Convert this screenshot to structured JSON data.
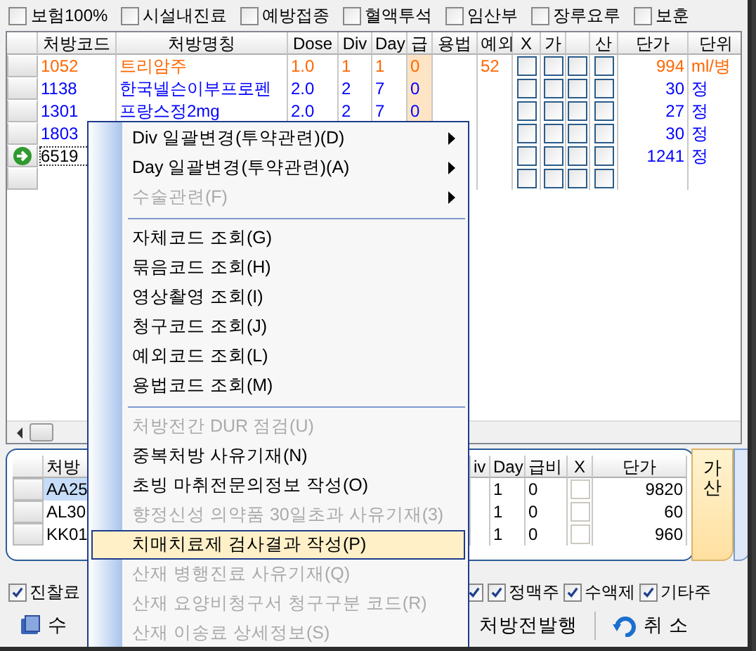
{
  "filters": [
    {
      "label": "보험100%",
      "checked": false
    },
    {
      "label": "시설내진료",
      "checked": false
    },
    {
      "label": "예방접종",
      "checked": false
    },
    {
      "label": "혈액투석",
      "checked": false
    },
    {
      "label": "임산부",
      "checked": false
    },
    {
      "label": "장루요루",
      "checked": false
    },
    {
      "label": "보훈",
      "checked": false
    }
  ],
  "grid": {
    "columns": [
      {
        "label": "처방코드"
      },
      {
        "label": "처방명칭"
      },
      {
        "label": "Dose"
      },
      {
        "label": "Div"
      },
      {
        "label": "Day"
      },
      {
        "label": "급"
      },
      {
        "label": "용법"
      },
      {
        "label": "예외"
      },
      {
        "label": "X"
      },
      {
        "label": "가"
      },
      {},
      {
        "label": "산"
      },
      {
        "label": "단가"
      },
      {
        "label": "단위"
      }
    ],
    "rows": [
      {
        "code": "1052",
        "name": "트리암주",
        "dose": "1.0",
        "div": "1",
        "day": "1",
        "grade": "0",
        "exception": "52",
        "price": "994",
        "unit": "ml/병",
        "color": "#ff6600",
        "selected": false,
        "flags": [
          {
            "checked": false
          },
          {
            "checked": false
          },
          {
            "checked": false
          },
          {
            "checked": false
          }
        ]
      },
      {
        "code": "1138",
        "name": "한국넬슨이부프로펜",
        "dose": "2.0",
        "div": "2",
        "day": "7",
        "grade": "0",
        "price": "30",
        "unit": "정",
        "color": "#0000ff",
        "selected": false,
        "flags": [
          {
            "checked": false
          },
          {
            "checked": false
          },
          {
            "checked": false
          },
          {
            "checked": false
          }
        ]
      },
      {
        "code": "1301",
        "name": "프랑스정2mg",
        "dose": "2.0",
        "div": "2",
        "day": "7",
        "grade": "0",
        "price": "27",
        "unit": "정",
        "color": "#0000ff",
        "selected": false,
        "flags": [
          {
            "checked": false
          },
          {
            "checked": false
          },
          {
            "checked": false
          },
          {
            "checked": false
          }
        ]
      },
      {
        "code": "1803",
        "price": "30",
        "unit": "정",
        "color": "#0000ff",
        "selected": false,
        "flags": [
          {
            "checked": false
          },
          {
            "checked": false
          },
          {
            "checked": false
          },
          {
            "checked": false
          }
        ]
      },
      {
        "code": "6519",
        "price": "1241",
        "unit": "정",
        "color": "#0000ff",
        "selected": true,
        "flags": [
          {
            "checked": false
          },
          {
            "checked": false
          },
          {
            "checked": false
          },
          {
            "checked": false
          }
        ]
      },
      {
        "selected": false,
        "flags": [
          {
            "checked": false
          },
          {
            "checked": false
          },
          {
            "checked": false
          },
          {
            "checked": false
          }
        ]
      }
    ]
  },
  "lower": {
    "columns": [
      {
        "label": "처방"
      },
      {
        "label": "iv"
      },
      {
        "label": "Day"
      },
      {
        "label": "급비"
      },
      {
        "label": "X"
      },
      {
        "label": "단가"
      }
    ],
    "rows": [
      {
        "code": "AA25",
        "day": "1",
        "grade": "0",
        "x": false,
        "price": "9820",
        "selected": true
      },
      {
        "code": "AL30",
        "day": "1",
        "grade": "0",
        "x": false,
        "price": "60",
        "selected": false
      },
      {
        "code": "KK01",
        "day": "1",
        "grade": "0",
        "x": false,
        "price": "960",
        "selected": false
      }
    ],
    "side_tabs": [
      {
        "label": "가산",
        "selected": true
      },
      {
        "selected": false
      }
    ]
  },
  "options_left": [
    {
      "label": "진찰료",
      "checked": true
    }
  ],
  "options_right": [
    {
      "checked": true
    },
    {
      "label": "정맥주",
      "checked": true
    },
    {
      "label": "수액제",
      "checked": true
    },
    {
      "label": "기타주",
      "checked": true
    }
  ],
  "toolbar": [
    {
      "kind": "pay",
      "label": "수"
    },
    {
      "kind": "print",
      "label": "처방전발행"
    },
    {
      "kind": "cancel",
      "label": "취 소"
    }
  ],
  "menu": {
    "items": [
      {
        "kind": "item",
        "label": "Div 일괄변경(투약관련)(D)",
        "submenu": true,
        "disabled": false,
        "selected": false
      },
      {
        "kind": "item",
        "label": "Day 일괄변경(투약관련)(A)",
        "submenu": true,
        "disabled": false,
        "selected": false
      },
      {
        "kind": "item",
        "label": "수술관련(F)",
        "submenu": true,
        "disabled": true,
        "selected": false
      },
      {
        "kind": "separator"
      },
      {
        "kind": "item",
        "label": "자체코드 조회(G)",
        "submenu": false,
        "disabled": false,
        "selected": false
      },
      {
        "kind": "item",
        "label": "묶음코드 조회(H)",
        "submenu": false,
        "disabled": false,
        "selected": false
      },
      {
        "kind": "item",
        "label": "영상촬영 조회(I)",
        "submenu": false,
        "disabled": false,
        "selected": false
      },
      {
        "kind": "item",
        "label": "청구코드 조회(J)",
        "submenu": false,
        "disabled": false,
        "selected": false
      },
      {
        "kind": "item",
        "label": "예외코드 조회(L)",
        "submenu": false,
        "disabled": false,
        "selected": false
      },
      {
        "kind": "item",
        "label": "용법코드 조회(M)",
        "submenu": false,
        "disabled": false,
        "selected": false
      },
      {
        "kind": "separator"
      },
      {
        "kind": "item",
        "label": "처방전간 DUR 점검(U)",
        "submenu": false,
        "disabled": true,
        "selected": false
      },
      {
        "kind": "item",
        "label": "중복처방 사유기재(N)",
        "submenu": false,
        "disabled": false,
        "selected": false
      },
      {
        "kind": "item",
        "label": "초빙 마취전문의정보 작성(O)",
        "submenu": false,
        "disabled": false,
        "selected": false
      },
      {
        "kind": "item",
        "label": "향정신성 의약품 30일초과 사유기재(3)",
        "submenu": false,
        "disabled": true,
        "selected": false
      },
      {
        "kind": "item",
        "label": "치매치료제 검사결과 작성(P)",
        "submenu": false,
        "disabled": false,
        "selected": true
      },
      {
        "kind": "item",
        "label": "산재 병행진료 사유기재(Q)",
        "submenu": false,
        "disabled": true,
        "selected": false
      },
      {
        "kind": "item",
        "label": "산재 요양비청구서 청구구분 코드(R)",
        "submenu": false,
        "disabled": true,
        "selected": false
      },
      {
        "kind": "item",
        "label": "산재 이송료 상세정보(S)",
        "submenu": false,
        "disabled": true,
        "selected": false
      }
    ]
  }
}
